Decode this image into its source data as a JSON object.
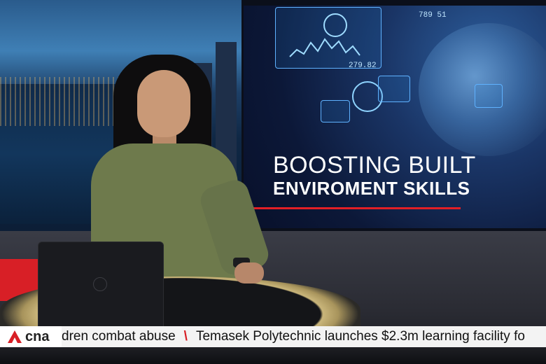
{
  "graphic": {
    "headline_line1": "BOOSTING BUILT",
    "headline_line2": "ENVIROMENT SKILLS",
    "hud_number_top": "789 51",
    "hud_number_bottom": "279.82",
    "colors": {
      "accent_red": "#e21f26",
      "hud_blue": "#5fb2ff"
    }
  },
  "ticker": {
    "channel_logo": "cna",
    "item_1": "dren combat abuse",
    "item_2": "Temasek Polytechnic launches $2.3m learning facility fo",
    "separator": "\\",
    "colors": {
      "logo_red": "#d81f26",
      "ticker_bg": "#f3f3f3"
    }
  }
}
